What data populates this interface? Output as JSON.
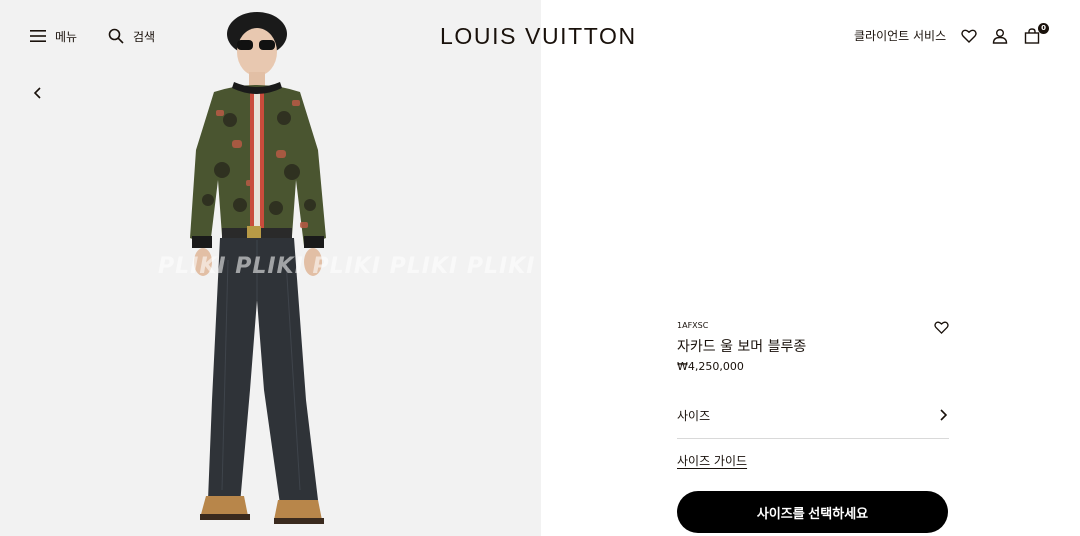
{
  "header": {
    "menu_label": "메뉴",
    "search_label": "검색",
    "brand": "LOUIS VUITTON",
    "client_service": "클라이언트 서비스",
    "bag_count": "0",
    "icons": {
      "menu": "menu-icon",
      "search": "search-icon",
      "wishlist": "heart-icon",
      "account": "user-icon",
      "bag": "bag-icon"
    }
  },
  "gallery": {
    "watermark": "PLIKI PLIKI PLIKI PLIKI PLIKI",
    "prev_icon": "chevron-left-icon"
  },
  "product": {
    "sku": "1AFXSC",
    "name": "자카드 울 보머 블루종",
    "price": "₩4,250,000",
    "size_label": "사이즈",
    "size_guide": "사이즈 가이드",
    "cta": "사이즈를 선택하세요"
  },
  "colors": {
    "text": "#19110b",
    "cta_bg": "#000000",
    "image_bg": "#f2f2f2",
    "divider": "#d9d9d9"
  }
}
